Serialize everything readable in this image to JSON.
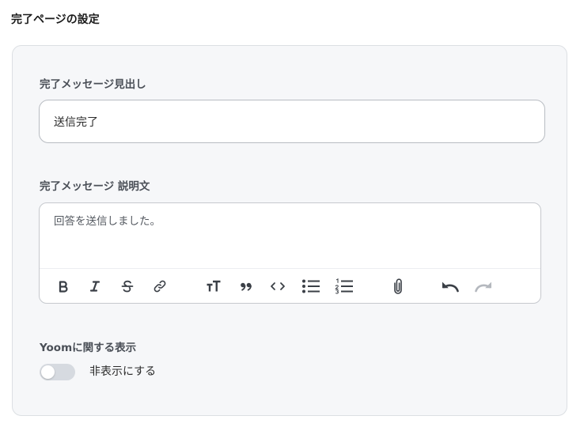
{
  "section": {
    "title": "完了ページの設定"
  },
  "heading_field": {
    "label": "完了メッセージ見出し",
    "value": "送信完了"
  },
  "description_field": {
    "label": "完了メッセージ 説明文",
    "value": "回答を送信しました。",
    "toolbar": [
      {
        "name": "bold-button",
        "icon": "bold-icon",
        "enabled": true
      },
      {
        "name": "italic-button",
        "icon": "italic-icon",
        "enabled": true
      },
      {
        "name": "strikethrough-button",
        "icon": "strikethrough-icon",
        "enabled": true
      },
      {
        "name": "link-button",
        "icon": "link-icon",
        "enabled": true
      },
      {
        "name": "heading-button",
        "icon": "text-size-icon",
        "enabled": true
      },
      {
        "name": "blockquote-button",
        "icon": "quote-icon",
        "enabled": true
      },
      {
        "name": "code-button",
        "icon": "code-icon",
        "enabled": true
      },
      {
        "name": "bullet-list-button",
        "icon": "bullet-list-icon",
        "enabled": true
      },
      {
        "name": "ordered-list-button",
        "icon": "ordered-list-icon",
        "enabled": true
      },
      {
        "name": "attach-button",
        "icon": "paperclip-icon",
        "enabled": true
      },
      {
        "name": "undo-button",
        "icon": "undo-icon",
        "enabled": true
      },
      {
        "name": "redo-button",
        "icon": "redo-icon",
        "enabled": false
      }
    ]
  },
  "yoom_display": {
    "label": "Yoomに関する表示",
    "toggle_label": "非表示にする",
    "toggle_on": false
  },
  "colors": {
    "card_bg": "#f6f7f9",
    "toggle_off": "#d6dae0",
    "icon": "#3a3f46",
    "icon_disabled": "#b4b8be"
  }
}
